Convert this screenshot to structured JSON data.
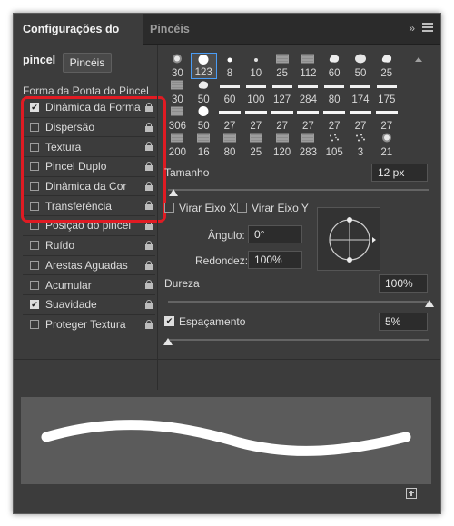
{
  "tabs": [
    {
      "label": "Configurações do pincel",
      "active": true
    },
    {
      "label": "Pincéis",
      "active": false
    }
  ],
  "left": {
    "pinceis_button": "Pincéis",
    "tip_shape_label": "Forma da Ponta do Pincel",
    "options": [
      {
        "label": "Dinâmica da Forma",
        "checked": true
      },
      {
        "label": "Dispersão",
        "checked": false
      },
      {
        "label": "Textura",
        "checked": false
      },
      {
        "label": "Pincel Duplo",
        "checked": false
      },
      {
        "label": "Dinâmica da Cor",
        "checked": false
      },
      {
        "label": "Transferência",
        "checked": false
      },
      {
        "label": "Posição do pincel",
        "checked": false
      },
      {
        "label": "Ruído",
        "checked": false
      },
      {
        "label": "Arestas Aguadas",
        "checked": false
      },
      {
        "label": "Acumular",
        "checked": false
      },
      {
        "label": "Suavidade",
        "checked": true
      },
      {
        "label": "Proteger Textura",
        "checked": false
      }
    ]
  },
  "brushes": {
    "rows": [
      [
        {
          "size": "30",
          "kind": "soft"
        },
        {
          "size": "123",
          "kind": "hard",
          "selected": true
        },
        {
          "size": "8",
          "kind": "tiny"
        },
        {
          "size": "10",
          "kind": "small"
        },
        {
          "size": "25",
          "kind": "texture"
        },
        {
          "size": "112",
          "kind": "texture"
        },
        {
          "size": "60",
          "kind": "splat"
        },
        {
          "size": "50",
          "kind": "cloud"
        },
        {
          "size": "25",
          "kind": "splat"
        }
      ],
      [
        {
          "size": "30",
          "kind": "texture"
        },
        {
          "size": "50",
          "kind": "splat"
        },
        {
          "size": "60",
          "kind": "line"
        },
        {
          "size": "100",
          "kind": "line"
        },
        {
          "size": "127",
          "kind": "line"
        },
        {
          "size": "284",
          "kind": "line"
        },
        {
          "size": "80",
          "kind": "line"
        },
        {
          "size": "174",
          "kind": "line"
        },
        {
          "size": "175",
          "kind": "line"
        }
      ],
      [
        {
          "size": "306",
          "kind": "texture"
        },
        {
          "size": "50",
          "kind": "hard"
        },
        {
          "size": "27",
          "kind": "bar"
        },
        {
          "size": "27",
          "kind": "bar"
        },
        {
          "size": "27",
          "kind": "bar"
        },
        {
          "size": "27",
          "kind": "bar"
        },
        {
          "size": "27",
          "kind": "bar"
        },
        {
          "size": "27",
          "kind": "bar"
        },
        {
          "size": "27",
          "kind": "bar"
        }
      ],
      [
        {
          "size": "200",
          "kind": "texture"
        },
        {
          "size": "16",
          "kind": "texture"
        },
        {
          "size": "80",
          "kind": "texture"
        },
        {
          "size": "25",
          "kind": "texture"
        },
        {
          "size": "120",
          "kind": "texture"
        },
        {
          "size": "283",
          "kind": "texture"
        },
        {
          "size": "105",
          "kind": "dots"
        },
        {
          "size": "3",
          "kind": "dots"
        },
        {
          "size": "21",
          "kind": "soft"
        }
      ]
    ]
  },
  "tamanho": {
    "label": "Tamanho",
    "value": "12 px",
    "level": 0.02
  },
  "flip_x": {
    "label": "Virar Eixo X",
    "checked": false
  },
  "flip_y": {
    "label": "Virar Eixo Y",
    "checked": false
  },
  "angulo": {
    "label": "Ângulo:",
    "value": "0°"
  },
  "redondez": {
    "label": "Redondez:",
    "value": "100%"
  },
  "dureza": {
    "label": "Dureza",
    "value": "100%",
    "level": 1.0
  },
  "espacamento": {
    "label": "Espaçamento",
    "value": "5%",
    "checked": true,
    "level": 0.0
  },
  "colors": {
    "panel": "#3c3c3c",
    "highlight": "#e01b23",
    "selection": "#4a9df7"
  }
}
